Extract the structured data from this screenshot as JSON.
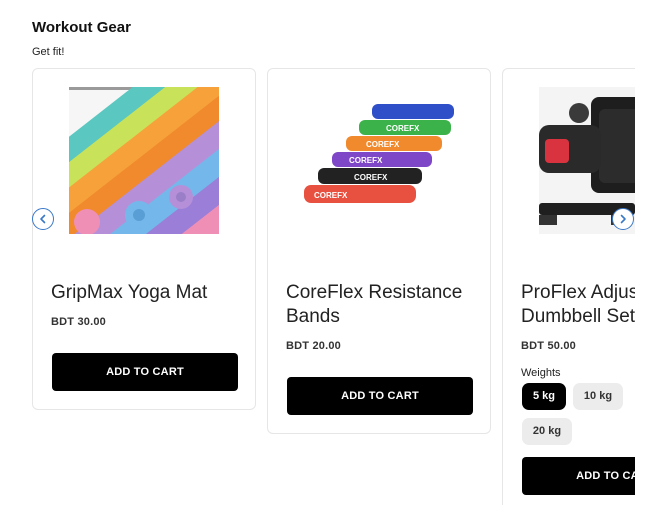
{
  "section": {
    "title": "Workout Gear",
    "subtitle": "Get fit!"
  },
  "products": [
    {
      "title": "GripMax Yoga Mat",
      "price": "BDT 30.00",
      "button": "ADD TO CART",
      "image_icon": "yoga-mat-image"
    },
    {
      "title_line1": "CoreFlex Resistance",
      "title_line2": "Bands",
      "price": "BDT 20.00",
      "button": "ADD TO CART",
      "image_icon": "resistance-bands-image",
      "band_text": "COREFX"
    },
    {
      "title_line1": "ProFlex Adjustable",
      "title_line2": "Dumbbell Set",
      "price": "BDT 50.00",
      "button": "ADD TO CART",
      "image_icon": "dumbbell-image",
      "option_label": "Weights",
      "options": [
        "5 kg",
        "10 kg",
        "20 kg"
      ],
      "selected_option": "5 kg"
    }
  ],
  "carousel": {
    "prev_icon": "chevron-left-icon",
    "next_icon": "chevron-right-icon",
    "accent": "#3a78c8"
  }
}
